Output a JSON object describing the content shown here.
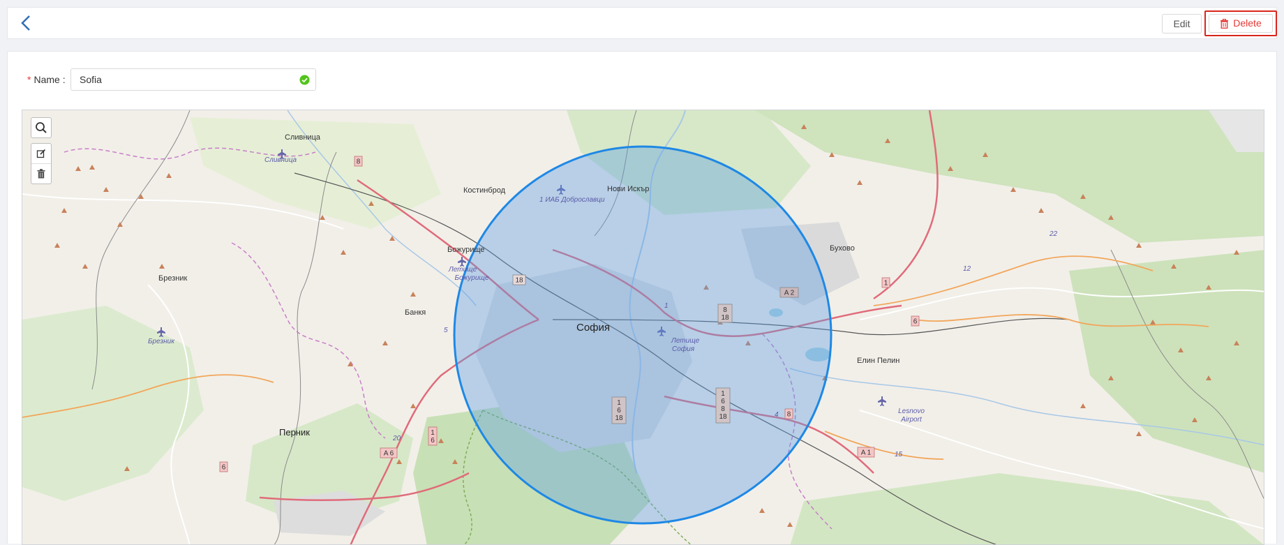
{
  "toolbar": {
    "back_icon": "chevron-left-icon",
    "edit_label": "Edit",
    "delete_label": "Delete",
    "delete_icon": "trash-icon",
    "delete_color": "#e53935"
  },
  "form": {
    "name_label": "Name",
    "name_required_mark": "*",
    "name_value": "Sofia",
    "name_valid_icon": "check-circle-icon",
    "valid_color": "#52c41a"
  },
  "map": {
    "controls": [
      "search-icon",
      "edit-icon",
      "trash-icon"
    ],
    "circle_color": "#1e88e5",
    "places": {
      "slivnica": "Сливница",
      "slivnica_airport": "Сливница",
      "kostinbrod": "Костинброд",
      "novi_iskar": "Нови Искър",
      "dobroslavtsi": "1 ИАБ Доброславци",
      "bozhurishte": "Божурище",
      "bozhurishte_airport_1": "Летище",
      "bozhurishte_airport_2": "Божурище",
      "breznik": "Брезник",
      "breznik_airport": "Брезник",
      "bankya": "Банкя",
      "sofia": "София",
      "sofia_airport_1": "Летище",
      "sofia_airport_2": "София",
      "buhovo": "Бухово",
      "elin_pelin": "Елин Пелин",
      "lesnovo_1": "Lesnovo",
      "lesnovo_2": "Airport",
      "pernik": "Перник"
    },
    "shields": {
      "r8": "8",
      "r18": "18",
      "a2": "A 2",
      "r1": "1",
      "r6": "6",
      "r8_18_a": "8",
      "r8_18_b": "18",
      "a6": "A 6",
      "a1": "A 1",
      "r6b": "6",
      "r8b": "8",
      "r1_6_a": "1",
      "r1_6_b": "6",
      "r1_6_18_a": "1",
      "r1_6_18_b": "6",
      "r1_6_18_c": "18",
      "r1_6_8_18_a": "1",
      "r1_6_8_18_b": "6",
      "r1_6_8_18_c": "8",
      "r1_6_8_18_d": "18"
    },
    "road_numbers": {
      "n22": "22",
      "n12": "12",
      "n5": "5",
      "n20": "20",
      "n15": "15",
      "n4": "4",
      "n1": "1"
    }
  }
}
